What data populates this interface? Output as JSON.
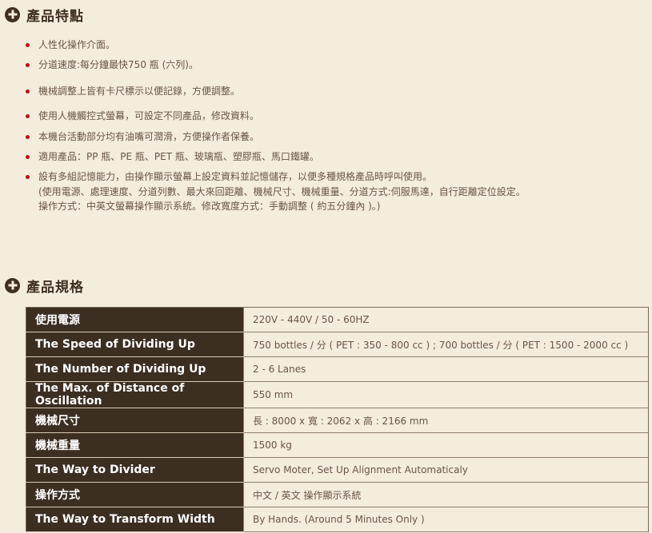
{
  "features_section": {
    "icon": "plus-circle-icon",
    "title": "產品特點",
    "items": [
      {
        "text": "人性化操作介面。"
      },
      {
        "text": "分道速度:每分鐘最快750 瓶 (六列)。"
      },
      {
        "text": "機械調整上皆有卡尺標示以便記錄，方便調整。"
      },
      {
        "text": "使用人機觸控式螢幕，可設定不同產品，修改資料。"
      },
      {
        "text": "本機台活動部分均有油嘴可潤滑，方便操作者保養。"
      },
      {
        "text": "適用產品：PP 瓶、PE 瓶、PET 瓶、玻璃瓶、塑膠瓶、馬口鐵罐。"
      },
      {
        "text": "設有多組記憶能力，由操作顯示螢幕上設定資料並記憶儲存，以便多種規格產品時呼叫使用。",
        "sub1": "(使用電源、處理速度、分道列數、最大來回距離、機械尺寸、機械重量、分道方式:伺服馬達，自行距離定位設定。",
        "sub2": "操作方式：中英文螢幕操作顯示系統。修改寬度方式：手動調整 ( 約五分鐘內 )。)"
      }
    ],
    "bullet_color": "#c0100e"
  },
  "specs_section": {
    "icon": "plus-circle-icon",
    "title": "產品規格",
    "rows": [
      {
        "label": "使用電源",
        "value": "220V - 440V / 50 - 60HZ"
      },
      {
        "label": "The Speed of Dividing Up",
        "value": "750 bottles / 分 ( PET : 350 - 800 cc ) ; 700 bottles / 分 ( PET : 1500 - 2000 cc )"
      },
      {
        "label": "The Number of Dividing Up",
        "value": "2 - 6 Lanes"
      },
      {
        "label": "The Max. of Distance of Oscillation",
        "value": "550 mm"
      },
      {
        "label": "機械尺寸",
        "value": "長 : 8000 x 寬 : 2062 x 高 : 2166 mm"
      },
      {
        "label": "機械重量",
        "value": "1500 kg"
      },
      {
        "label": "The Way to Divider",
        "value": "Servo Moter, Set Up Alignment Automaticaly"
      },
      {
        "label": "操作方式",
        "value": "中文 / 英文 操作顯示系統"
      },
      {
        "label": "The Way to Transform Width",
        "value": "By Hands. (Around 5 Minutes Only )"
      }
    ],
    "label_bg": "#3d2e22"
  },
  "colors": {
    "background": "#f4ecdd",
    "heading": "#3f2f22",
    "text": "#6a5646"
  }
}
